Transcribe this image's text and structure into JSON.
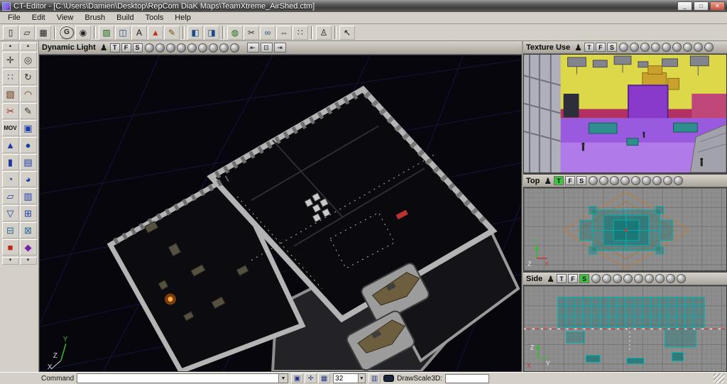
{
  "window": {
    "title": "CT-Editor - [C:\\Users\\Damien\\Desktop\\RepCom DiaK Maps\\TeamXtreme_AirShed.ctm]",
    "controls": [
      {
        "name": "minimize-button",
        "glyph": "_"
      },
      {
        "name": "maximize-button",
        "glyph": "□"
      },
      {
        "name": "close-button",
        "glyph": "✕",
        "cls": "close"
      }
    ]
  },
  "menu": [
    {
      "name": "menu-file",
      "label": "File"
    },
    {
      "name": "menu-edit",
      "label": "Edit"
    },
    {
      "name": "menu-view",
      "label": "View"
    },
    {
      "name": "menu-brush",
      "label": "Brush"
    },
    {
      "name": "menu-build",
      "label": "Build"
    },
    {
      "name": "menu-tools",
      "label": "Tools"
    },
    {
      "name": "menu-help",
      "label": "Help"
    }
  ],
  "toolbar": [
    {
      "name": "new-map-icon",
      "glyph": "▯"
    },
    {
      "name": "open-map-icon",
      "glyph": "▱"
    },
    {
      "name": "save-map-icon",
      "glyph": "▦"
    },
    {
      "cls": "sep"
    },
    {
      "name": "search-icon",
      "glyph": "G",
      "cls": "circled"
    },
    {
      "name": "camera-speed-icon",
      "glyph": "◉"
    },
    {
      "cls": "sep"
    },
    {
      "name": "texture-browser-icon",
      "glyph": "▨",
      "color": "#1a6a1a"
    },
    {
      "name": "mesh-browser-icon",
      "glyph": "◫",
      "color": "#1a4a8a"
    },
    {
      "name": "actor-browser-icon",
      "glyph": "A",
      "color": "#111111"
    },
    {
      "name": "prefab-browser-icon",
      "glyph": "▲",
      "color": "#c03020"
    },
    {
      "name": "surface-properties-icon",
      "glyph": "✎",
      "color": "#7a4a10"
    },
    {
      "cls": "sep"
    },
    {
      "name": "split-horizontal-icon",
      "glyph": "◧",
      "color": "#1a4a8a"
    },
    {
      "name": "split-vertical-icon",
      "glyph": "◨",
      "color": "#1a4a8a"
    },
    {
      "cls": "sep"
    },
    {
      "name": "terrain-mode-icon",
      "glyph": "◍",
      "color": "#1a6a1a"
    },
    {
      "name": "cut-tool-icon",
      "glyph": "✂",
      "color": "#333333"
    },
    {
      "name": "link-tool-icon",
      "glyph": "∞",
      "color": "#1a4a8a"
    },
    {
      "name": "measure-tool-icon",
      "glyph": "⇔",
      "color": "#333333"
    },
    {
      "name": "snap-grid-icon",
      "glyph": "∷",
      "color": "#333333"
    },
    {
      "cls": "sep"
    },
    {
      "name": "player-start-icon",
      "glyph": "♙",
      "color": "#111111"
    },
    {
      "cls": "sep"
    },
    {
      "name": "select-cursor-icon",
      "glyph": "↖",
      "color": "#111111"
    }
  ],
  "sidebar_tools": [
    {
      "name": "camera-move-tool",
      "glyph": "✛"
    },
    {
      "name": "zoom-tool",
      "glyph": "◎"
    },
    {
      "name": "vertex-edit-tool",
      "glyph": "∷",
      "color": "#1a4a8a"
    },
    {
      "name": "rotate-tool",
      "glyph": "↻"
    },
    {
      "name": "texture-pan-tool",
      "glyph": "▨",
      "color": "#6a3a1a"
    },
    {
      "name": "texture-rotate-tool",
      "glyph": "◠",
      "color": "#6a3a1a"
    },
    {
      "name": "clip-tool",
      "glyph": "✂",
      "color": "#a22222"
    },
    {
      "name": "polygon-draw-tool",
      "glyph": "✎"
    },
    {
      "name": "mov-tool",
      "glyph": "MOV",
      "cls": "txt"
    },
    {
      "name": "brush-edit-tool",
      "glyph": "▣",
      "color": "#1a3aa8"
    },
    {
      "name": "cone-brush-tool",
      "glyph": "▲",
      "color": "#1a3aa8"
    },
    {
      "name": "sphere-brush-tool",
      "glyph": "●",
      "color": "#1a3aa8"
    },
    {
      "name": "cylinder-brush-tool",
      "glyph": "▮",
      "color": "#1a3aa8"
    },
    {
      "name": "stairs-brush-tool",
      "glyph": "▤",
      "color": "#1a3aa8"
    },
    {
      "name": "curved-stairs-brush-tool",
      "glyph": "◔",
      "color": "#1a3aa8"
    },
    {
      "name": "spiral-stairs-brush-tool",
      "glyph": "◕",
      "color": "#1a3aa8"
    },
    {
      "name": "sheet-brush-tool",
      "glyph": "▱",
      "color": "#1a3aa8"
    },
    {
      "name": "volume-brush-tool",
      "glyph": "▥",
      "color": "#1a3aa8"
    },
    {
      "name": "terrain-brush-tool",
      "glyph": "▽",
      "color": "#1a3aa8"
    },
    {
      "name": "add-brush-button",
      "glyph": "⊞",
      "color": "#1a3aa8"
    },
    {
      "name": "subtract-brush-button",
      "glyph": "⊟",
      "color": "#2a6a9a"
    },
    {
      "name": "intersect-brush-button",
      "glyph": "⊠",
      "color": "#2a6a9a"
    },
    {
      "name": "special-brush-button",
      "glyph": "■",
      "color": "#c22222"
    },
    {
      "name": "mover-brush-button",
      "glyph": "◆",
      "color": "#7a22aa"
    }
  ],
  "header_modes": [
    {
      "name": "wireframe-mode-icon"
    },
    {
      "name": "zone-portal-mode-icon"
    },
    {
      "name": "texture-use-mode-icon"
    },
    {
      "name": "bsp-cut-mode-icon"
    },
    {
      "name": "lighting-mode-icon"
    },
    {
      "name": "dynamic-light-mode-icon"
    },
    {
      "name": "textured-mode-icon"
    },
    {
      "name": "depth-complexity-mode-icon"
    },
    {
      "name": "camera-mode-icon"
    }
  ],
  "main_nav": [
    {
      "name": "camera-back-icon",
      "glyph": "⇤"
    },
    {
      "name": "camera-overhead-icon",
      "glyph": "⊡"
    },
    {
      "name": "camera-forward-icon",
      "glyph": "⇥"
    }
  ],
  "viewports": {
    "main": {
      "title": "Dynamic Light",
      "toggles": [
        {
          "name": "main-toggle-t",
          "label": "T"
        },
        {
          "name": "main-toggle-f",
          "label": "F"
        },
        {
          "name": "main-toggle-s",
          "label": "S"
        }
      ]
    },
    "texture_use": {
      "title": "Texture Use",
      "toggles": [
        {
          "name": "texture-toggle-t",
          "label": "T"
        },
        {
          "name": "texture-toggle-f",
          "label": "F"
        },
        {
          "name": "texture-toggle-s",
          "label": "S"
        }
      ]
    },
    "top": {
      "title": "Top",
      "active_toggle": "T",
      "toggles": [
        {
          "name": "top-toggle-t",
          "label": "T",
          "cls": "active"
        },
        {
          "name": "top-toggle-f",
          "label": "F"
        },
        {
          "name": "top-toggle-s",
          "label": "S"
        }
      ]
    },
    "side": {
      "title": "Side",
      "active_toggle": "S",
      "toggles": [
        {
          "name": "side-toggle-t",
          "label": "T"
        },
        {
          "name": "side-toggle-f",
          "label": "F"
        },
        {
          "name": "side-toggle-s",
          "label": "S",
          "cls": "active"
        }
      ]
    }
  },
  "statusbar": {
    "command_label": "Command",
    "command_value": "",
    "grid_size": "32",
    "drawscale_label": "DrawScale3D:",
    "drawscale_value": "",
    "icons": [
      {
        "name": "viewport-maximize-icon",
        "glyph": "▣"
      },
      {
        "name": "move-mode-icon",
        "glyph": "✛"
      },
      {
        "name": "grid-snap-icon",
        "glyph": "▦"
      }
    ],
    "icons2": [
      {
        "name": "rotation-grid-icon",
        "glyph": "▥"
      }
    ]
  },
  "icons": {
    "player_glyph": "♟",
    "dropdown_glyph": "▼",
    "scroll_up": "▲",
    "scroll_down": "▼"
  },
  "axis": {
    "x": "X",
    "y": "Y",
    "z": "Z"
  },
  "colors": {
    "chrome": "#d4d0c8",
    "viewport-bg": "#06060c",
    "grid-blue": "#15153c",
    "wall-gray": "#b4b4b4",
    "panel-gray": "#8e8e8e",
    "teal": "#00b2b2",
    "orange-outline": "#c87830",
    "yellow": "#ddd84a",
    "purple-slab": "#8a3ac8",
    "floor-purple": "#9a5ae0",
    "magenta-band": "#b23062",
    "active-green": "#3ec43e",
    "axis-green": "#2fbf2f",
    "axis-red": "#d03030"
  }
}
